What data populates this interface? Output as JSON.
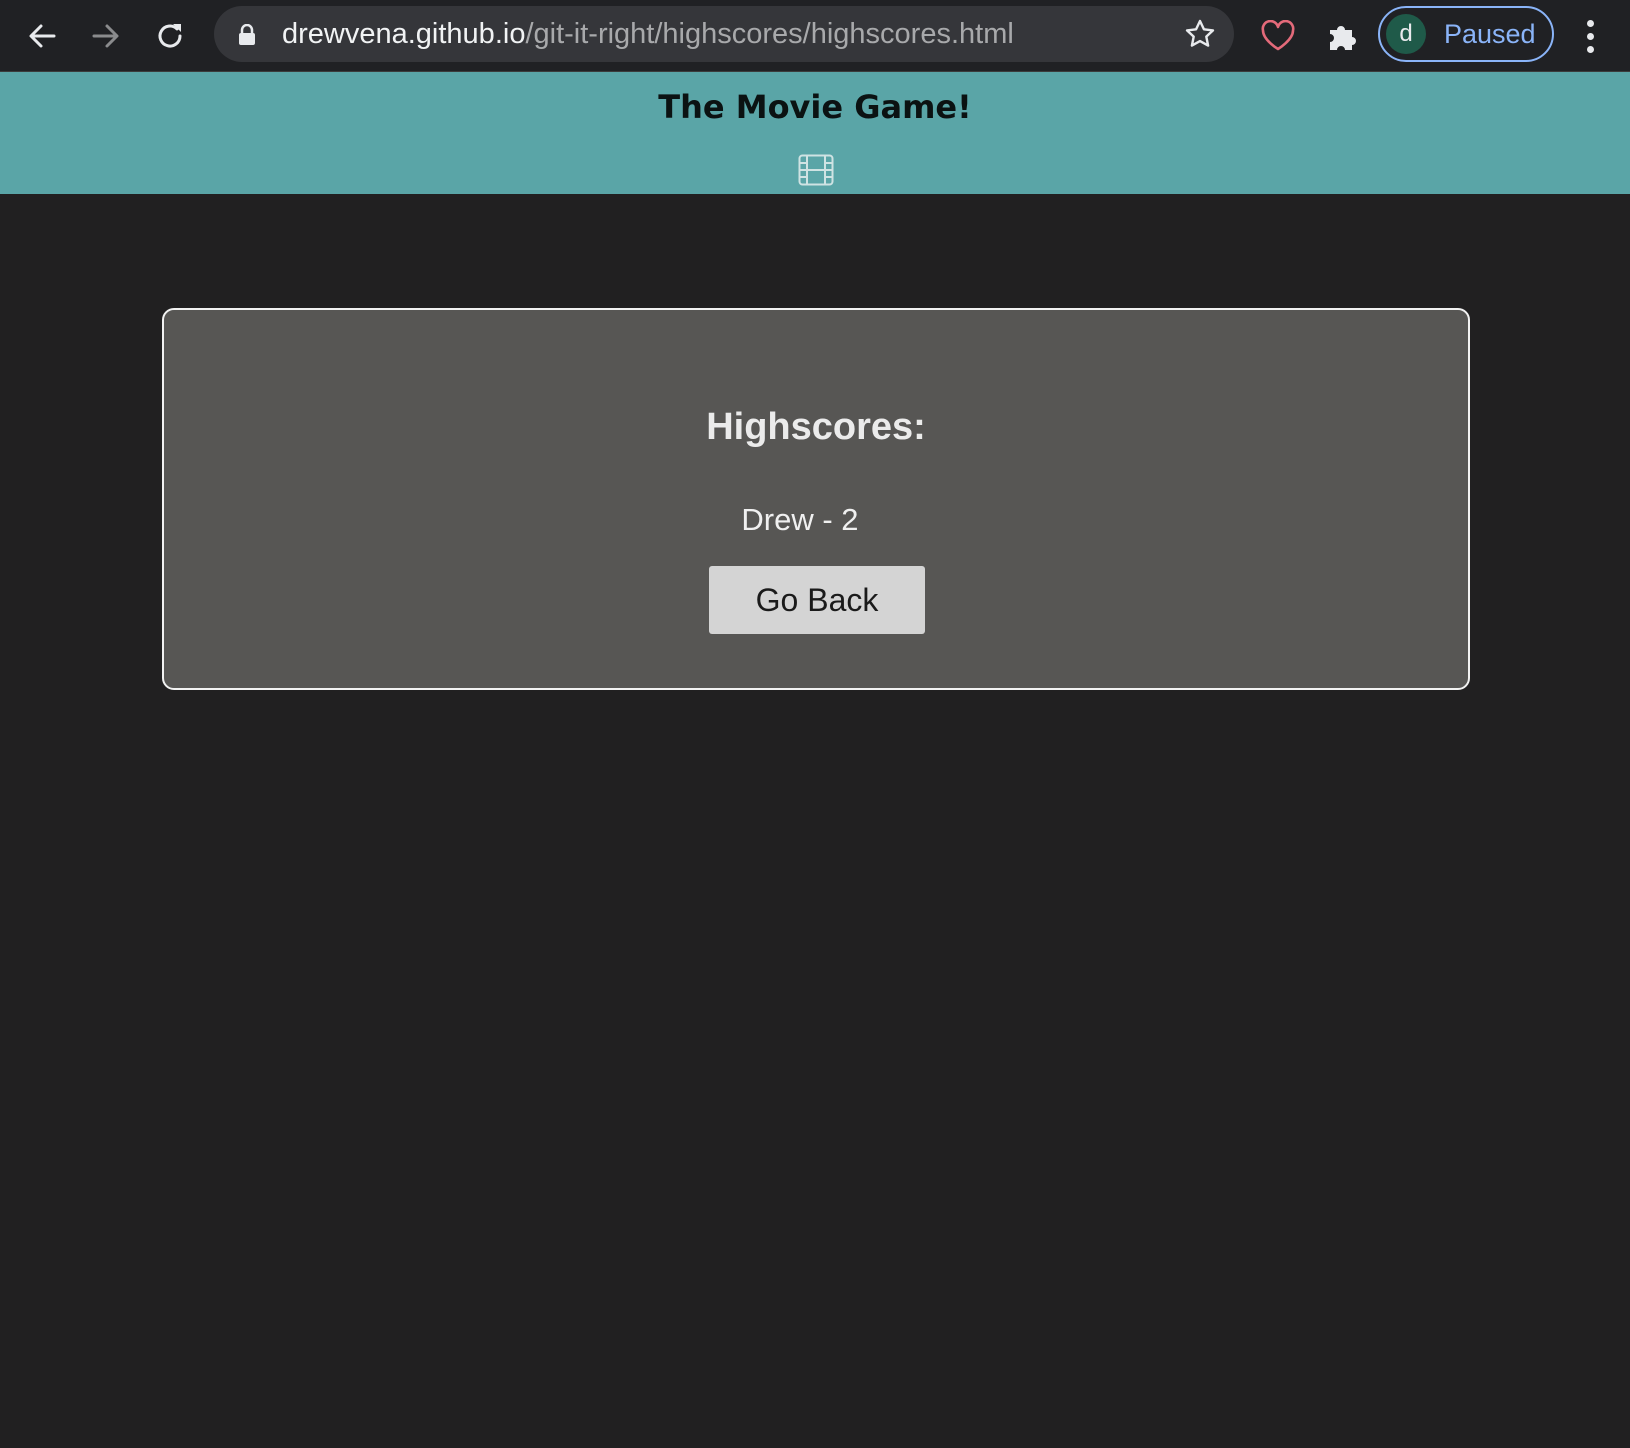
{
  "browser": {
    "url_host": "drewvena.github.io",
    "url_path": "/git-it-right/highscores/highscores.html",
    "profile_initial": "d",
    "profile_status": "Paused",
    "icons": [
      "back-arrow-icon",
      "forward-arrow-icon",
      "reload-icon",
      "lock-icon",
      "star-icon",
      "heart-icon",
      "puzzle-icon",
      "more-vert-icon"
    ],
    "colors": {
      "toolbar": "#202124",
      "omnibox": "#35363a",
      "profile_accent": "#8ab4f8",
      "heart": "#e46a7a"
    }
  },
  "header": {
    "title": "The Movie Game!",
    "icon": "film-icon",
    "background": "#5aa5a7"
  },
  "highscores": {
    "title": "Highscores:",
    "entries": [
      "Drew - 2"
    ],
    "go_back_label": "Go Back"
  },
  "page": {
    "background": "#212021",
    "card_background": "#575654"
  }
}
